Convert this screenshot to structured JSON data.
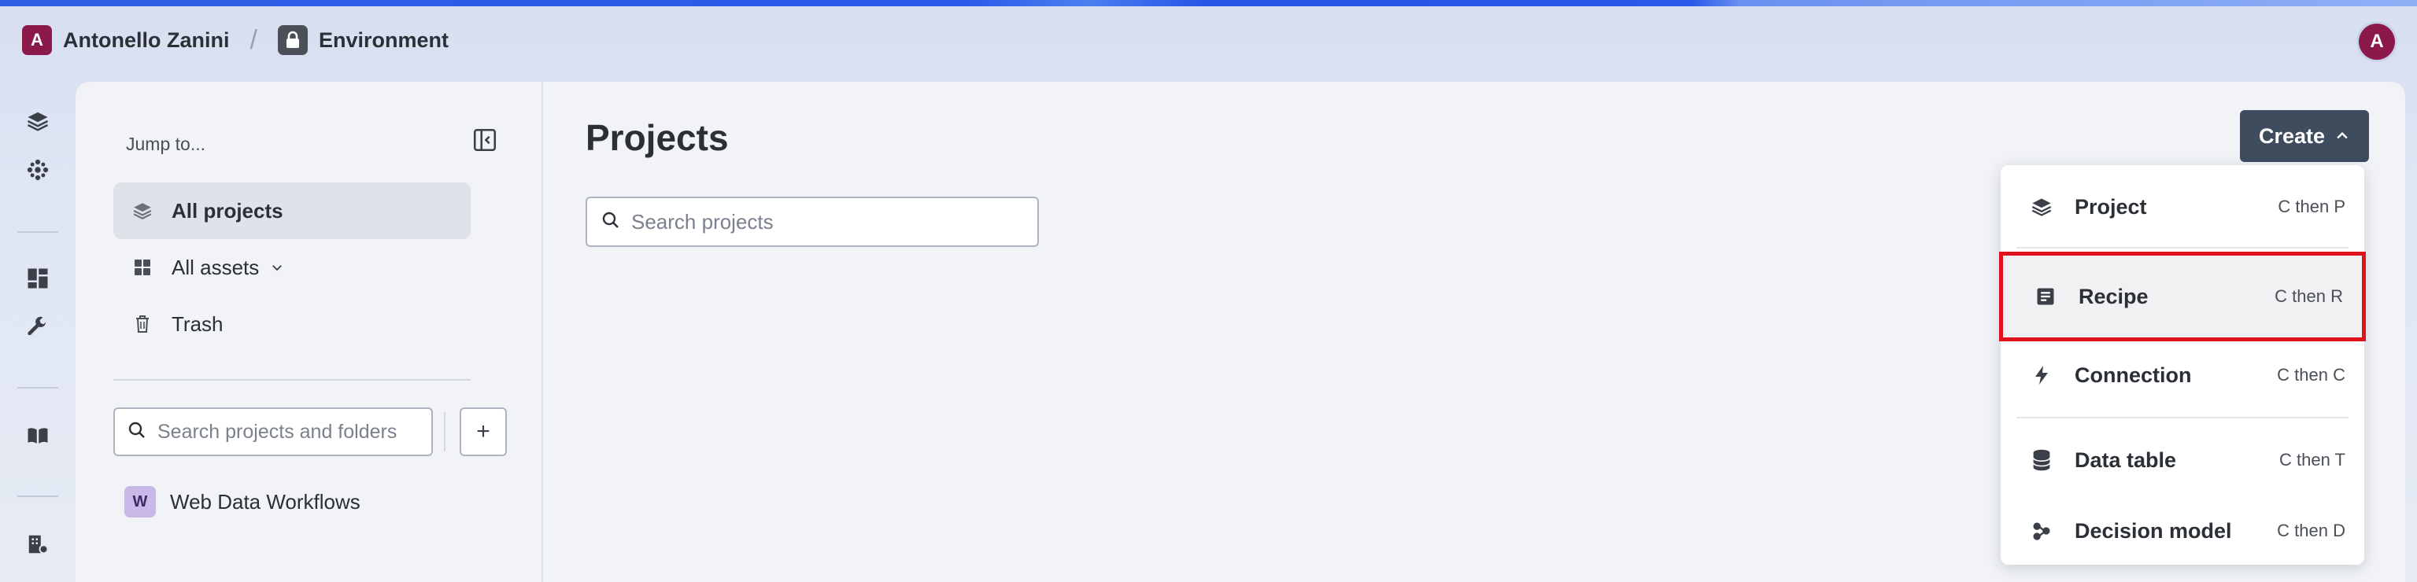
{
  "header": {
    "org_initial": "A",
    "org_name": "Antonello Zanini",
    "separator": "/",
    "environment": "Environment",
    "user_initial": "A"
  },
  "rail": {
    "items": [
      "projects-icon",
      "automation-icon",
      "dashboard-icon",
      "tools-icon",
      "docs-icon",
      "workspace-admin-icon"
    ]
  },
  "sidebar": {
    "jump_label": "Jump to...",
    "nav": [
      {
        "label": "All projects",
        "icon": "layers-icon",
        "active": true
      },
      {
        "label": "All assets",
        "icon": "grid-icon",
        "active": false
      },
      {
        "label": "Trash",
        "icon": "trash-icon",
        "active": false
      }
    ],
    "search_placeholder": "Search projects and folders",
    "add_label": "+",
    "projects": [
      {
        "badge": "W",
        "name": "Web Data Workflows"
      }
    ]
  },
  "main": {
    "title": "Projects",
    "search_placeholder": "Search projects",
    "create_label": "Create"
  },
  "create_menu": {
    "items": [
      {
        "label": "Project",
        "shortcut": "C then P",
        "icon": "layers-icon"
      },
      {
        "label": "Recipe",
        "shortcut": "C then R",
        "icon": "recipe-icon",
        "highlighted": true
      },
      {
        "label": "Connection",
        "shortcut": "C then C",
        "icon": "lightning-icon"
      },
      {
        "label": "Data table",
        "shortcut": "C then T",
        "icon": "database-icon"
      },
      {
        "label": "Decision model",
        "shortcut": "C then D",
        "icon": "decision-model-icon"
      }
    ],
    "highlight_color": "#e0121b"
  },
  "colors": {
    "accent": "#2f5fe6",
    "brand": "#8b1a4a",
    "create_button": "#3e4c5e"
  }
}
